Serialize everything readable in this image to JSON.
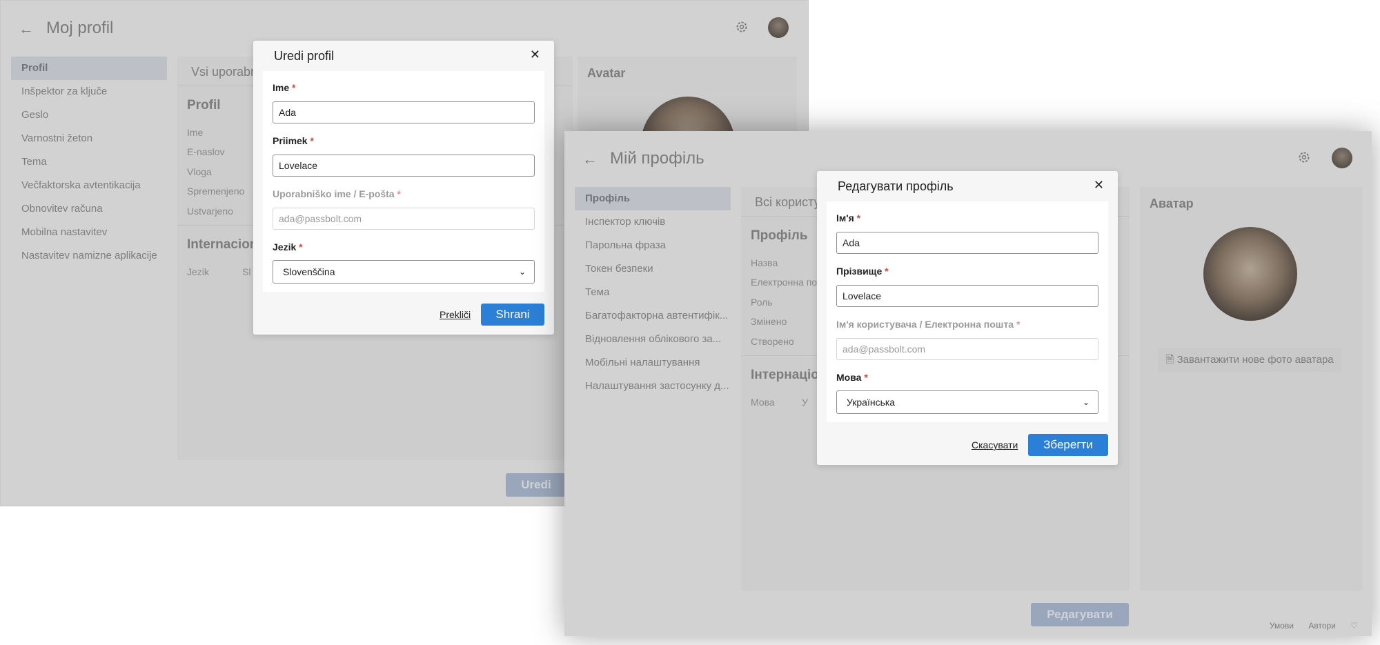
{
  "window_sl": {
    "title": "Moj profil",
    "nav": [
      "Profil",
      "Inšpektor za ključe",
      "Geslo",
      "Varnostni žeton",
      "Tema",
      "Večfaktorska avtentikacija",
      "Obnovitev računa",
      "Mobilna nastavitev",
      "Nastavitev namizne aplikacije"
    ],
    "tab_label": "Vsi uporabn",
    "profile_title": "Profil",
    "fields": [
      "Ime",
      "E-naslov",
      "Vloga",
      "Spremenjeno",
      "Ustvarjeno"
    ],
    "intl_title": "Internacion",
    "lang_label": "Jezik",
    "lang_value": "Sl",
    "avatar_title": "Avatar",
    "edit_button": "Uredi",
    "dialog": {
      "title": "Uredi profil",
      "first_name_label": "Ime",
      "first_name_value": "Ada",
      "last_name_label": "Priimek",
      "last_name_value": "Lovelace",
      "username_label": "Uporabniško ime / E-pošta",
      "username_value": "ada@passbolt.com",
      "language_label": "Jezik",
      "language_value": "Slovenščina",
      "cancel": "Prekliči",
      "save": "Shrani"
    }
  },
  "window_uk": {
    "title": "Мій профіль",
    "nav": [
      "Профіль",
      "Інспектор ключів",
      "Парольна фраза",
      "Токен безпеки",
      "Тема",
      "Багатофакторна автентифік...",
      "Відновлення облікового за...",
      "Мобільні налаштування",
      "Налаштування застосунку д..."
    ],
    "tab_label": "Всі користу",
    "profile_title": "Профіль",
    "fields": [
      "Назва",
      "Електронна по",
      "Роль",
      "Змінено",
      "Створено"
    ],
    "intl_title": "Інтернаціон",
    "lang_label": "Мова",
    "lang_value": "У",
    "avatar_title": "Аватар",
    "upload_button": "Завантажити нове фото аватара",
    "edit_button": "Редагувати",
    "footer": [
      "Умови",
      "Автори"
    ],
    "dialog": {
      "title": "Редагувати профіль",
      "first_name_label": "Ім'я",
      "first_name_value": "Ada",
      "last_name_label": "Прізвище",
      "last_name_value": "Lovelace",
      "username_label": "Ім'я користувача / Електронна пошта",
      "username_value": "ada@passbolt.com",
      "language_label": "Мова",
      "language_value": "Українська",
      "cancel": "Скасувати",
      "save": "Зберегти"
    }
  },
  "icons": {
    "back": "arrow-left-icon",
    "settings": "gear-icon",
    "close": "close-icon",
    "chevron": "chevron-down-icon",
    "upload": "file-icon",
    "heart": "heart-icon"
  },
  "colors": {
    "primary": "#2c7fd6",
    "required": "#d64545",
    "nav_active_bg": "#d9dde4"
  }
}
